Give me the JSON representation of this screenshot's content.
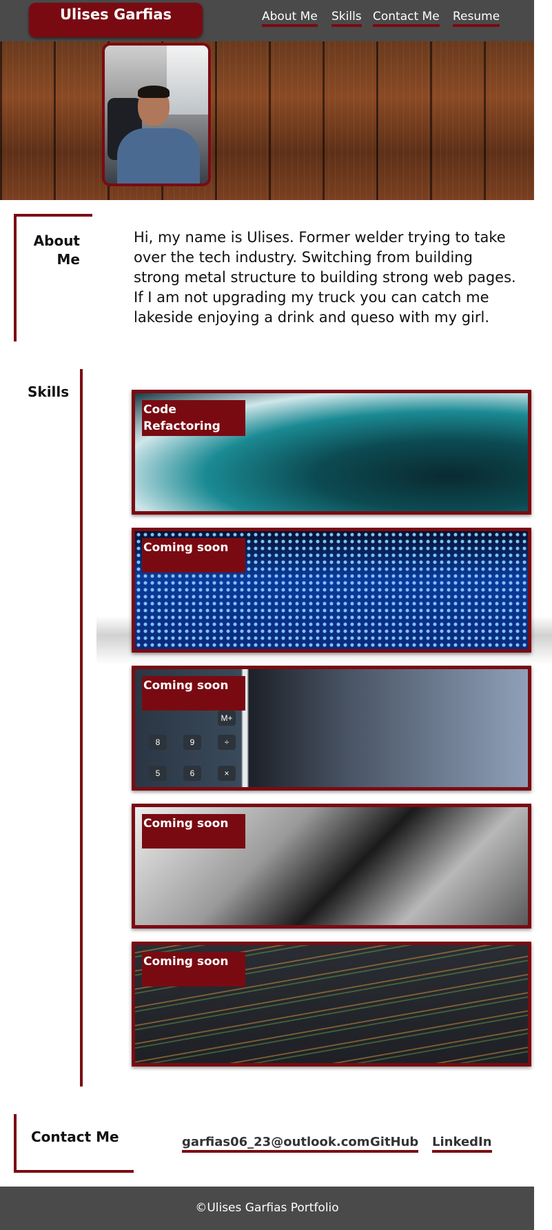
{
  "header": {
    "brand": "Ulises Garfias",
    "nav": [
      "About Me",
      "Skills",
      "Contact Me",
      "Resume"
    ]
  },
  "hero": {
    "avatar_icon": "profile-photo"
  },
  "about": {
    "title": "About Me",
    "text": "Hi, my name is Ulises. Former welder trying to take over the tech industry. Switching from building strong metal structure to building strong web pages. If I am not upgrading my truck you can catch me lakeside enjoying a drink and queso with my girl."
  },
  "skills": {
    "title": "Skills",
    "cards": [
      {
        "label": "Code Refactoring"
      },
      {
        "label": "Coming soon"
      },
      {
        "label": "Coming soon"
      },
      {
        "label": "Coming soon"
      },
      {
        "label": "Coming soon"
      }
    ],
    "calc_keys": [
      "M+",
      "8",
      "9",
      "÷",
      "5",
      "6",
      "×"
    ]
  },
  "contact": {
    "title": "Contact Me",
    "links": [
      "garfias06_23@outlook.com",
      "GitHub",
      "LinkedIn"
    ]
  },
  "footer": {
    "text": "©Ulises Garfias Portfolio"
  },
  "colors": {
    "accent": "#7a0a12",
    "header_bg": "#4a4a4a"
  }
}
